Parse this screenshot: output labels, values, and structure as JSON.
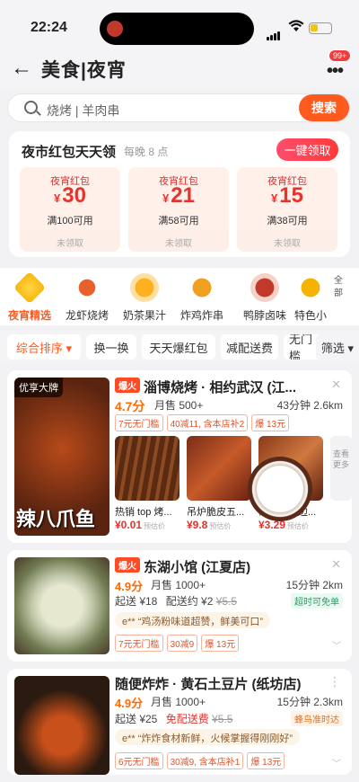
{
  "status_bar": {
    "time": "22:24"
  },
  "nav": {
    "title": "美食|夜宵",
    "notify_count": "99+"
  },
  "search": {
    "placeholder": "烧烤 | 羊肉串",
    "button": "搜索"
  },
  "red_packet": {
    "title": "夜市红包天天领",
    "subtitle": "每晚 8 点",
    "claim_all": "一键领取",
    "coupons": [
      {
        "name": "夜宵红包",
        "currency": "¥",
        "amount": "30",
        "condition": "满100可用",
        "state": "未领取"
      },
      {
        "name": "夜宵红包",
        "currency": "¥",
        "amount": "21",
        "condition": "满58可用",
        "state": "未领取"
      },
      {
        "name": "夜宵红包",
        "currency": "¥",
        "amount": "15",
        "condition": "满38可用",
        "state": "未领取"
      }
    ]
  },
  "categories": [
    {
      "label": "夜宵精选"
    },
    {
      "label": "龙虾烧烤"
    },
    {
      "label": "奶茶果汁"
    },
    {
      "label": "炸鸡炸串"
    },
    {
      "label": "鸭脖卤味"
    },
    {
      "label": "特色小"
    }
  ],
  "categories_all": "全部",
  "filters": [
    {
      "label": "综合排序 ▾"
    },
    {
      "label": "换一换"
    },
    {
      "label": "天天爆红包"
    },
    {
      "label": "减配送费"
    },
    {
      "label": "无门槛"
    },
    {
      "label": "筛选 ▾"
    }
  ],
  "shops": [
    {
      "badge": "优享大牌",
      "hot": "爆火",
      "name": "淄博烧烤 · 相约武汉 (江...",
      "rating": "4.7分",
      "sales": "月售 500+",
      "distance": "43分钟 2.6km",
      "tags": [
        "7元无门槛",
        "40减11, 含本店补2",
        "爆 13元"
      ],
      "photo_caption": "辣八爪鱼",
      "dishes": [
        {
          "name": "热销 top 烤...",
          "price": "¥0.01",
          "note": "预估价"
        },
        {
          "name": "吊炉脆皮五...",
          "price": "¥9.8",
          "note": "预估价"
        },
        {
          "name": "东北大油边...",
          "price": "¥3.29",
          "note": "预估价"
        }
      ],
      "see_more": "查看更多"
    },
    {
      "hot": "爆火",
      "name": "东湖小馆 (江夏店)",
      "rating": "4.9分",
      "sales": "月售 1000+",
      "distance": "15分钟 2km",
      "min_order": "起送 ¥18",
      "delivery": "配送约 ¥2",
      "delivery_old": "¥5.5",
      "guarantee": "超时可免单",
      "review": "e** “鸡汤粉味道超赞，鲜美可口”",
      "tags": [
        "7元无门槛",
        "30减9",
        "爆 13元"
      ]
    },
    {
      "name": "随便炸炸 · 黄石土豆片 (纸坊店)",
      "rating": "4.9分",
      "sales": "月售 1000+",
      "distance": "15分钟 2.3km",
      "min_order": "起送 ¥25",
      "delivery": "免配送费",
      "delivery_old": "¥5.5",
      "guarantee": "蜂鸟准时达",
      "review": "e** “炸炸食材新鲜，火候掌握得刚刚好”",
      "tags": [
        "6元无门槛",
        "30减9, 含本店补1",
        "爆 13元"
      ]
    }
  ],
  "colors": {
    "accent": "#ff5a1e",
    "price": "#e5342e",
    "rating": "#ff6a00"
  }
}
